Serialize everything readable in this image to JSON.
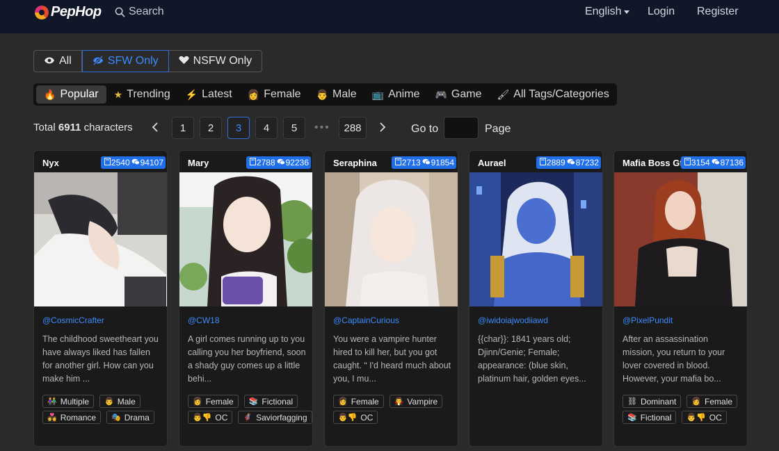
{
  "header": {
    "logo_text": "PepHop",
    "search_label": "Search",
    "language": "English",
    "login": "Login",
    "register": "Register"
  },
  "filters": [
    {
      "label": "All",
      "icon": "eye-icon",
      "active": false
    },
    {
      "label": "SFW Only",
      "icon": "eye-slash-icon",
      "active": true
    },
    {
      "label": "NSFW Only",
      "icon": "heart-icon",
      "active": false
    }
  ],
  "categories": [
    {
      "label": "Popular",
      "icon": "fire-icon",
      "glyph": "🔥",
      "active": true
    },
    {
      "label": "Trending",
      "icon": "star-icon",
      "glyph": "★",
      "active": false
    },
    {
      "label": "Latest",
      "icon": "lightning-icon",
      "glyph": "⚡",
      "active": false
    },
    {
      "label": "Female",
      "icon": "woman-icon",
      "glyph": "👩",
      "active": false
    },
    {
      "label": "Male",
      "icon": "man-icon",
      "glyph": "👨",
      "active": false
    },
    {
      "label": "Anime",
      "icon": "tv-icon",
      "glyph": "📺",
      "active": false
    },
    {
      "label": "Game",
      "icon": "gamepad-icon",
      "glyph": "🎮",
      "active": false
    },
    {
      "label": "All Tags/Categories",
      "icon": "brush-icon",
      "glyph": "🖌",
      "active": false
    }
  ],
  "pagination": {
    "total_prefix": "Total",
    "total_count": "6911",
    "total_suffix": "characters",
    "pages": [
      "1",
      "2",
      "3",
      "4",
      "5"
    ],
    "current": "3",
    "dots": "•••",
    "last_page": "288",
    "goto_label": "Go to",
    "page_label": "Page"
  },
  "colors": {
    "accent": "#1f6feb",
    "link": "#3d8bfd",
    "header_bg": "#0f1728",
    "page_bg": "#2a2a2a"
  },
  "cards": [
    {
      "name": "Nyx",
      "bookmarks": "2540",
      "chats": "94107",
      "author": "@CosmicCrafter",
      "desc": "The childhood sweetheart you have always liked has fallen for another girl. How can you make him ...",
      "tags": [
        {
          "emoji": "👫",
          "label": "Multiple"
        },
        {
          "emoji": "👨",
          "label": "Male"
        },
        {
          "emoji": "💑",
          "label": "Romance"
        },
        {
          "emoji": "🎭",
          "label": "Drama"
        }
      ]
    },
    {
      "name": "Mary",
      "bookmarks": "2788",
      "chats": "92236",
      "author": "@CW18",
      "desc": "A girl comes running up to you calling you her boyfriend, soon a shady guy comes up a little behi...",
      "tags": [
        {
          "emoji": "👩",
          "label": "Female"
        },
        {
          "emoji": "📚",
          "label": "Fictional"
        },
        {
          "emoji": "👨👎",
          "label": "OC"
        },
        {
          "emoji": "🦸",
          "label": "Saviorfagging"
        }
      ]
    },
    {
      "name": "Seraphina",
      "bookmarks": "2713",
      "chats": "91854",
      "author": "@CaptainCurious",
      "desc": "You were a vampire hunter hired to kill her, but you got caught. “ I'd heard much about you, I mu...",
      "tags": [
        {
          "emoji": "👩",
          "label": "Female"
        },
        {
          "emoji": "🧛",
          "label": "Vampire"
        },
        {
          "emoji": "👨👎",
          "label": "OC"
        }
      ]
    },
    {
      "name": "Aurael",
      "bookmarks": "2889",
      "chats": "87232",
      "author": "@iwidoiajwodiiawd",
      "desc": "{{char}}: 1841 years old; Djinn/Genie; Female; appearance: (blue skin, platinum hair, golden eyes...",
      "tags": []
    },
    {
      "name": "Mafia Boss Gf",
      "bookmarks": "3154",
      "chats": "87136",
      "author": "@PixelPundit",
      "desc": "After an assassination mission, you return to your lover covered in blood. However, your mafia bo...",
      "tags": [
        {
          "emoji": "⛓",
          "label": "Dominant"
        },
        {
          "emoji": "👩",
          "label": "Female"
        },
        {
          "emoji": "📚",
          "label": "Fictional"
        },
        {
          "emoji": "👨👎",
          "label": "OC"
        }
      ]
    }
  ]
}
